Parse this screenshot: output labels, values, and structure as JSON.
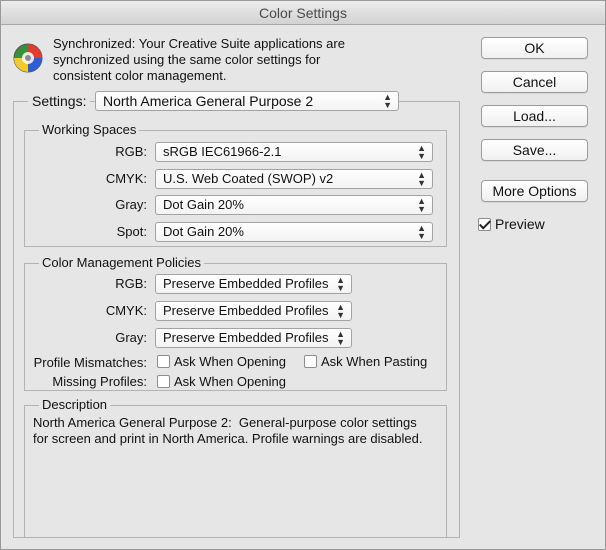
{
  "window": {
    "title": "Color Settings"
  },
  "sync": {
    "line1": "Synchronized: Your Creative Suite applications are",
    "line2": "synchronized using the same color settings for",
    "line3": "consistent color management."
  },
  "buttons": {
    "ok": "OK",
    "cancel": "Cancel",
    "load": "Load...",
    "save": "Save...",
    "more_options": "More Options"
  },
  "preview": {
    "label": "Preview",
    "checked": true
  },
  "settings": {
    "label": "Settings:",
    "value": "North America General Purpose 2"
  },
  "working_spaces": {
    "title": "Working Spaces",
    "rgb": {
      "label": "RGB:",
      "value": "sRGB IEC61966-2.1"
    },
    "cmyk": {
      "label": "CMYK:",
      "value": "U.S. Web Coated (SWOP) v2"
    },
    "gray": {
      "label": "Gray:",
      "value": "Dot Gain 20%"
    },
    "spot": {
      "label": "Spot:",
      "value": "Dot Gain 20%"
    }
  },
  "policies": {
    "title": "Color Management Policies",
    "rgb": {
      "label": "RGB:",
      "value": "Preserve Embedded Profiles"
    },
    "cmyk": {
      "label": "CMYK:",
      "value": "Preserve Embedded Profiles"
    },
    "gray": {
      "label": "Gray:",
      "value": "Preserve Embedded Profiles"
    },
    "profile_mismatches": {
      "label": "Profile Mismatches:",
      "ask_opening": "Ask When Opening",
      "ask_pasting": "Ask When Pasting"
    },
    "missing_profiles": {
      "label": "Missing Profiles:",
      "ask_opening": "Ask When Opening"
    }
  },
  "description": {
    "title": "Description",
    "line1": "North America General Purpose 2:  General-purpose color settings",
    "line2": "for screen and print in North America. Profile warnings are disabled."
  }
}
